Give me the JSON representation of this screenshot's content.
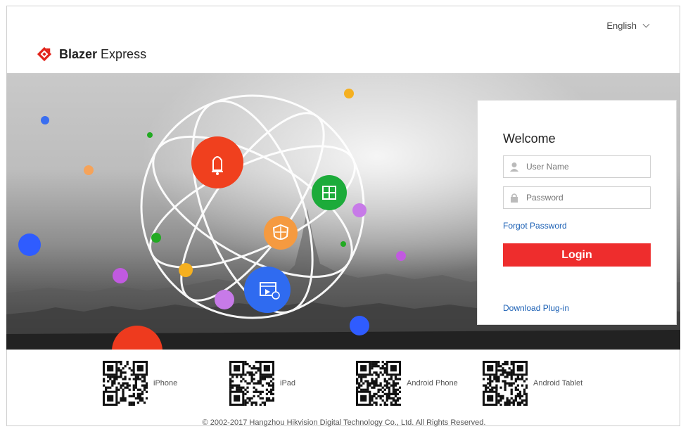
{
  "header": {
    "brand_bold": "Blazer",
    "brand_light": "Express",
    "language": "English",
    "logo_color": "#e2231a"
  },
  "login": {
    "welcome": "Welcome",
    "username_placeholder": "User Name",
    "password_placeholder": "Password",
    "forgot_label": "Forgot Password",
    "login_label": "Login",
    "download_label": "Download Plug-in",
    "accent_color": "#ee2d2d",
    "link_color": "#1a5fb4"
  },
  "apps": [
    {
      "label": "iPhone"
    },
    {
      "label": "iPad"
    },
    {
      "label": "Android Phone"
    },
    {
      "label": "Android Tablet"
    }
  ],
  "footer": {
    "copyright": "© 2002-2017 Hangzhou Hikvision Digital Technology Co., Ltd. All Rights Reserved."
  },
  "hero_icons": [
    "bell-icon",
    "grid-icon",
    "shield-icon",
    "video-icon"
  ]
}
